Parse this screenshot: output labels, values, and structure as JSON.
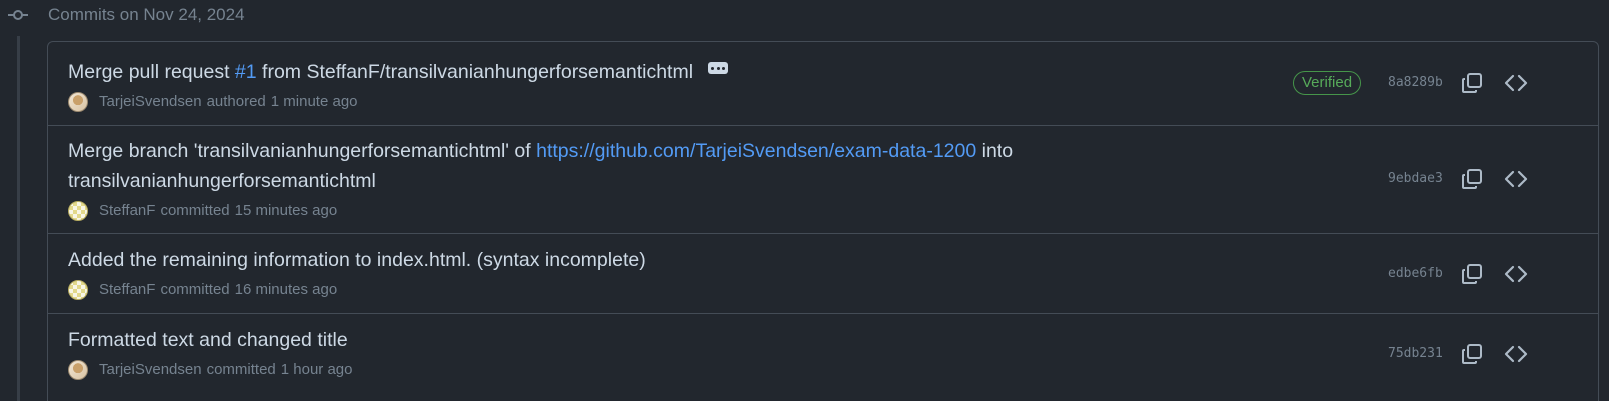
{
  "group": {
    "title": "Commits on Nov 24, 2024",
    "node_icon": "git-commit-icon"
  },
  "commits": [
    {
      "message_prefix": "Merge pull request ",
      "message_link": "#1",
      "message_suffix": " from SteffanF/transilvanianhungerforsemantichtml",
      "has_ellipsis": true,
      "author": "TarjeiSvendsen",
      "action": "authored",
      "time": "1 minute ago",
      "verified_label": "Verified",
      "sha": "8a8289b"
    },
    {
      "message_prefix": "Merge branch 'transilvanianhungerforsemantichtml' of ",
      "message_link": "https://github.com/TarjeiSvendsen/exam-data-1200",
      "message_suffix": " into",
      "message_line2": "transilvanianhungerforsemantichtml",
      "author": "SteffanF",
      "action": "committed",
      "time": "15 minutes ago",
      "sha": "9ebdae3"
    },
    {
      "message": "Added the remaining information to index.html. (syntax incomplete)",
      "author": "SteffanF",
      "action": "committed",
      "time": "16 minutes ago",
      "sha": "edbe6fb"
    },
    {
      "message": "Formatted text and changed title",
      "author": "TarjeiSvendsen",
      "action": "committed",
      "time": "1 hour ago",
      "sha": "75db231"
    }
  ],
  "icons": {
    "copy": "copy-icon",
    "browse": "code-icon",
    "ellipsis": "ellipsis-icon"
  },
  "colors": {
    "background": "#22272e",
    "border": "#444c56",
    "text_primary": "#cdd9e5",
    "text_muted": "#768390",
    "link": "#539bf5",
    "verified": "#57ab5a"
  }
}
